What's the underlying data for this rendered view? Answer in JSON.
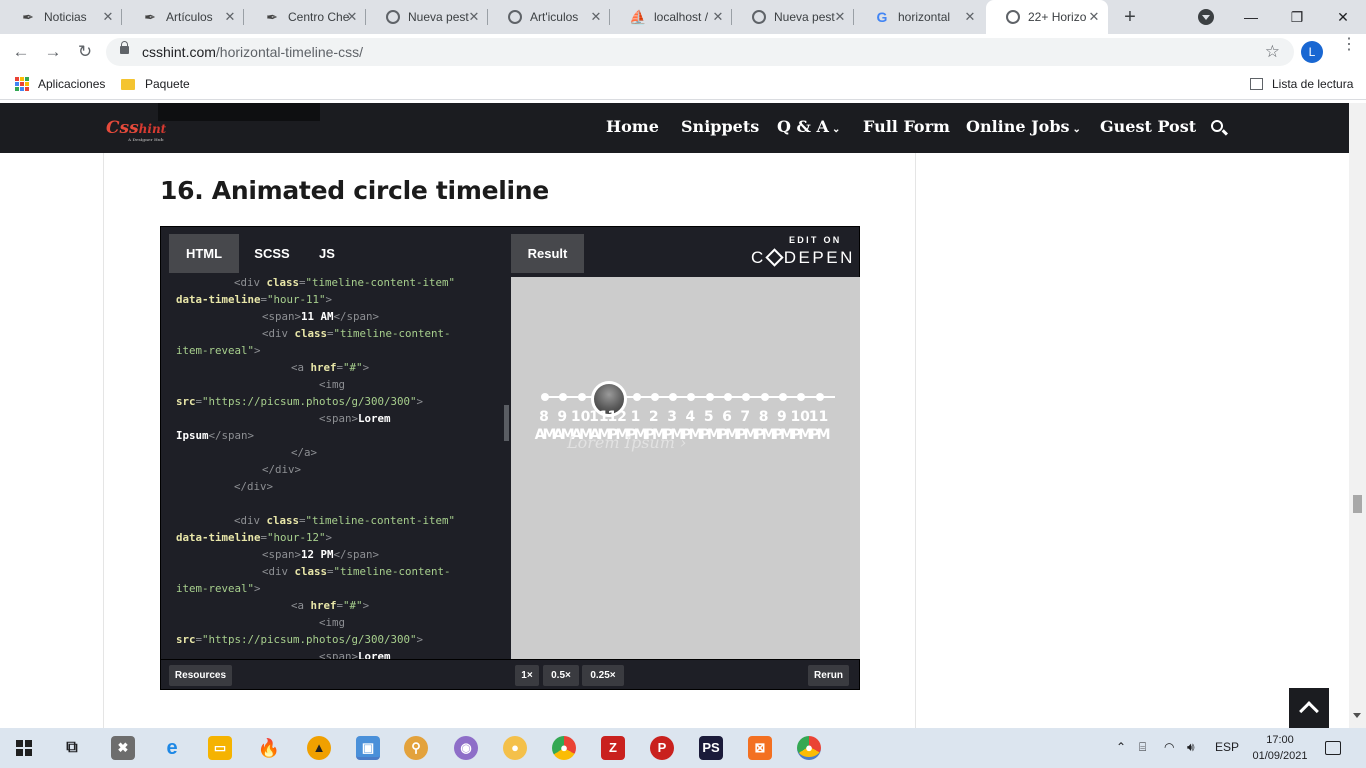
{
  "browser": {
    "tabs": [
      {
        "title": "Noticias",
        "icon": "quill-icon"
      },
      {
        "title": "Artículos",
        "icon": "quill-icon"
      },
      {
        "title": "Centro Che",
        "icon": "quill-icon"
      },
      {
        "title": "Nueva pest",
        "icon": "globe-icon"
      },
      {
        "title": "Art'iculos",
        "icon": "globe-icon"
      },
      {
        "title": "localhost /",
        "icon": "phpmyadmin-icon"
      },
      {
        "title": "Nueva pest",
        "icon": "globe-icon"
      },
      {
        "title": "horizontal",
        "icon": "google-icon"
      },
      {
        "title": "22+ Horizo",
        "icon": "globe-icon",
        "active": true
      }
    ],
    "url_host": "csshint.com",
    "url_path": "/horizontal-timeline-css/",
    "profile_initial": "L",
    "bookmarks": [
      {
        "label": "Aplicaciones",
        "icon": "apps-grid-icon"
      },
      {
        "label": "Paquete",
        "icon": "folder-icon"
      }
    ],
    "reading_list": "Lista de lectura"
  },
  "site": {
    "logo": "Css",
    "logo_hint": "hint",
    "logo_tag": "A Designer Hub",
    "nav": [
      {
        "label": "Home",
        "dropdown": false
      },
      {
        "label": "Snippets",
        "dropdown": false
      },
      {
        "label": "Q & A",
        "dropdown": true
      },
      {
        "label": "Full Form",
        "dropdown": false
      },
      {
        "label": "Online Jobs",
        "dropdown": true
      },
      {
        "label": "Guest Post",
        "dropdown": false
      }
    ],
    "heading": "16. Animated circle timeline"
  },
  "codepen": {
    "tabs": [
      "HTML",
      "SCSS",
      "JS"
    ],
    "result_tab": "Result",
    "edit_on": "EDIT ON",
    "brand_left": "C",
    "brand_right": "DEPEN",
    "code_lines": [
      "<div class=\"timeline-content-item\"",
      "data-timeline=\"hour-11\">",
      "<span>11 AM</span>",
      "<div class=\"timeline-content-",
      "item-reveal\">",
      "<a href=\"#\">",
      "<img",
      "src=\"https://picsum.photos/g/300/300\">",
      "<span>Lorem",
      "Ipsum</span>",
      "</a>",
      "</div>",
      "</div>",
      "",
      "<div class=\"timeline-content-item\"",
      "data-timeline=\"hour-12\">",
      "<span>12 PM</span>",
      "<div class=\"timeline-content-",
      "item-reveal\">",
      "<a href=\"#\">",
      "<img",
      "src=\"https://picsum.photos/g/300/300\">",
      "<span>Lorem"
    ],
    "timeline_hours": [
      "8",
      "9",
      "10",
      "11",
      "12",
      "1",
      "2",
      "3",
      "4",
      "5",
      "6",
      "7",
      "8",
      "9",
      "10",
      "11"
    ],
    "timeline_meridiem": [
      "AM",
      "AM",
      "AM",
      "AM",
      "PM",
      "PM",
      "PM",
      "PM",
      "PM",
      "PM",
      "PM",
      "PM",
      "PM",
      "PM",
      "PM",
      "PM"
    ],
    "active_hour_index": 3,
    "reveal_text": "Lorem Ipsum ›",
    "footer": {
      "resources": "Resources",
      "zoom": [
        "1×",
        "0.5×",
        "0.25×"
      ],
      "rerun": "Rerun"
    }
  },
  "taskbar": {
    "lang": "ESP",
    "time": "17:00",
    "date": "01/09/2021"
  }
}
